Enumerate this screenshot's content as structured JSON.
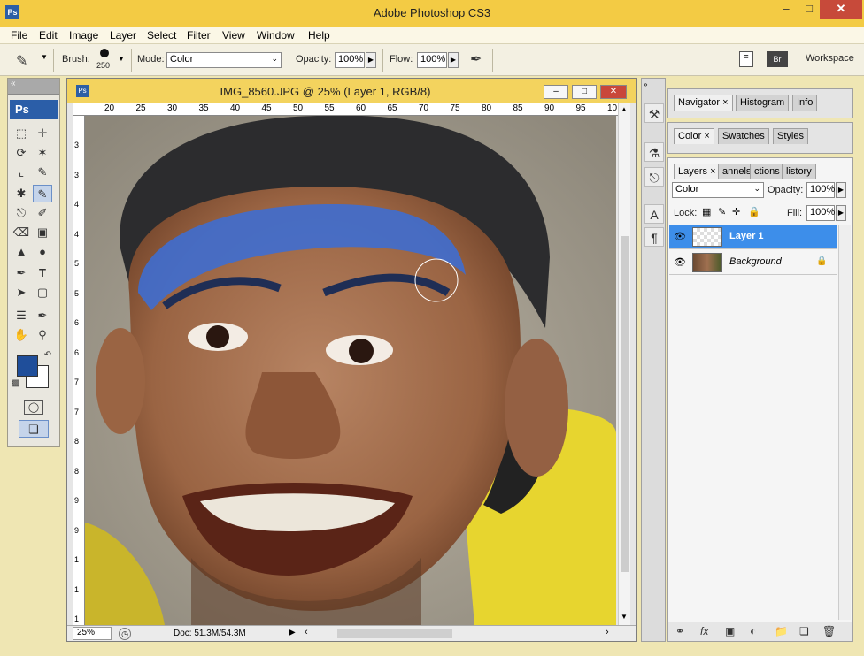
{
  "app": {
    "title": "Adobe Photoshop CS3",
    "logo": "Ps"
  },
  "menu": [
    "File",
    "Edit",
    "Image",
    "Layer",
    "Select",
    "Filter",
    "View",
    "Window",
    "Help"
  ],
  "options": {
    "brush_label": "Brush:",
    "brush_size": "250",
    "mode_label": "Mode:",
    "mode_value": "Color",
    "opacity_label": "Opacity:",
    "opacity_value": "100%",
    "flow_label": "Flow:",
    "flow_value": "100%",
    "workspace_label": "Workspace"
  },
  "document": {
    "logo": "Ps",
    "title": "IMG_8560.JPG @ 25% (Layer 1, RGB/8)",
    "ruler_top": [
      "20",
      "25",
      "30",
      "35",
      "40",
      "45",
      "50",
      "55",
      "60",
      "65",
      "70",
      "75",
      "80",
      "85",
      "90",
      "95",
      "10"
    ],
    "ruler_left": [
      "3",
      "3",
      "4",
      "4",
      "5",
      "5",
      "6",
      "6",
      "7",
      "7",
      "8",
      "8",
      "9",
      "9",
      "1",
      "1",
      "1"
    ],
    "zoom": "25%",
    "doc_size": "Doc: 51.3M/54.3M"
  },
  "panels": {
    "group1_tabs": [
      "Navigator",
      "Histogram",
      "Info"
    ],
    "group2_tabs": [
      "Color",
      "Swatches",
      "Styles"
    ],
    "layers_tabs": [
      "Layers",
      "annels",
      "ctions",
      "listory"
    ],
    "blend_mode": "Color",
    "opacity_label": "Opacity:",
    "opacity_value": "100%",
    "lock_label": "Lock:",
    "fill_label": "Fill:",
    "fill_value": "100%",
    "layers": [
      {
        "name": "Layer 1",
        "selected": true
      },
      {
        "name": "Background",
        "selected": false
      }
    ]
  },
  "colors": {
    "foreground": "#1f4e9a",
    "background": "#ffffff",
    "title_bar": "#f3cb44",
    "selection": "#3d8eea"
  }
}
